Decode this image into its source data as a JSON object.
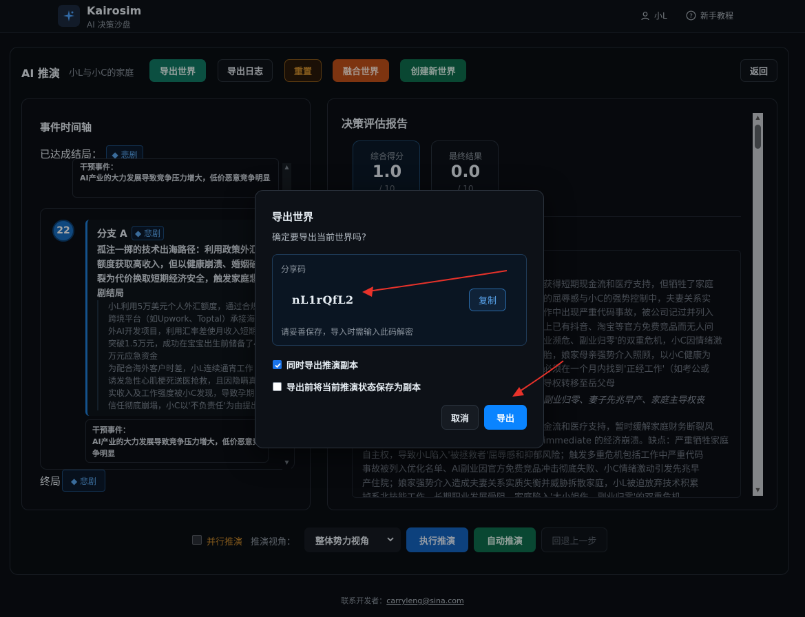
{
  "brand": {
    "name": "Kairosim",
    "subtitle": "AI 决策沙盘"
  },
  "nav": {
    "user": "小L",
    "help": "新手教程"
  },
  "header": {
    "title": "AI 推演",
    "world_name": "小L与小C的家庭",
    "buttons": {
      "export_world": "导出世界",
      "export_log": "导出日志",
      "reset": "重置",
      "merge_world": "融合世界",
      "create_world": "创建新世界",
      "back": "返回"
    }
  },
  "timeline": {
    "title": "事件时间轴",
    "reached_label": "已达成结局：",
    "reached_tag": "◆ 悲剧",
    "top_event": {
      "label": "干预事件：",
      "text": "AI产业的大力发展导致竞争压力增大，低价恶意竞争明显"
    },
    "branch": {
      "index": "22",
      "name": "分支 A",
      "tag": "◆ 悲剧",
      "desc": "孤注一掷的技术出海路径：利用政策外汇额度获取高收入，但以健康崩溃、婚姻破裂为代价换取短期经济安全，触发家庭悲剧结局",
      "body": "小L利用5万美元个人外汇额度，通过合规跨境平台（如Upwork、Toptal）承接海外AI开发项目，利用汇率差使月收入短期突破1.5万元，成功在宝宝出生前储备了4万元应急资金\n为配合海外客户时差，小L连续通宵工作诱发急性心肌梗死送医抢救，且因隐瞒真实收入及工作强度被小C发现，导致孕期信任彻底崩塌，小C以'不负责任'为由提出离婚并要求分割共同财产"
    },
    "bottom_event": {
      "label": "干预事件：",
      "text": "AI产业的大力发展导致竞争压力增大，低价恶意竞争明显"
    },
    "end_label": "终局",
    "end_tag": "◆ 悲剧"
  },
  "report": {
    "title": "决策评估报告",
    "scores": [
      {
        "label": "综合得分",
        "value": "1.0",
        "denominator": "/ 10"
      },
      {
        "label": "最终结果",
        "value": "0.0",
        "denominator": "/ 10"
      }
    ],
    "analysis_lines": [
      "获得短期现金流和医疗支持，但牺牲了家庭",
      "的屈辱感与小C的强势控制中，夫妻关系实",
      "作中出现严重代码事故，被公司记过并列入",
      "上已有抖音、淘宝等官方免费竞品而无人问",
      "业濒危、副业归零'的双重危机，小C因情绪激",
      "胎，娘家母亲强势介入照顾，以小C健康为",
      "必须在一个月内找到'正经工作'（如考公或",
      "导权转移至岳父母"
    ],
    "analysis_em": "副业归零、妻子先兆早产、家庭主导权丧",
    "analysis_lines2": [
      "金流和医疗支持，暂时缓解家庭财务断裂风",
      "immediate 的经济崩溃。缺点：严重牺牲家庭",
      "自主权，导致小L陷入'被拯救者'屈辱感和抑郁风险；触发多重危机包括工作中严重代码",
      "事故被列入优化名单、AI副业因官方免费竞品冲击彻底失败、小C情绪激动引发先兆早",
      "产住院；娘家强势介入造成夫妻关系实质失衡并威胁拆散家庭，小L被迫放弃技术积累",
      "掉系北技能工作，长期职业发展受阻，家庭陷入'大小姐伤，副业归零'的双重危机"
    ]
  },
  "controls": {
    "parallel_label": "并行推演",
    "view_label": "推演视角：",
    "view_value": "整体势力视角",
    "run": "执行推演",
    "auto": "自动推演",
    "undo": "回退上一步"
  },
  "footer": {
    "prefix": "联系开发者：",
    "email": "carryleng@sina.com"
  },
  "modal": {
    "title": "导出世界",
    "subtitle": "确定要导出当前世界吗?",
    "share_label": "分享码",
    "share_code": "nL1rQfL2",
    "copy": "复制",
    "note": "请妥善保存，导入时需输入此码解密",
    "option1": "同时导出推演副本",
    "option1_checked": true,
    "option2": "导出前将当前推演状态保存为副本",
    "option2_checked": false,
    "cancel": "取消",
    "confirm": "导出"
  },
  "colors": {
    "accent_blue": "#0a84ff",
    "teal": "#117a65",
    "green": "#0f6e4e",
    "orange": "#c0501a",
    "arrow_red": "#e8322a"
  }
}
